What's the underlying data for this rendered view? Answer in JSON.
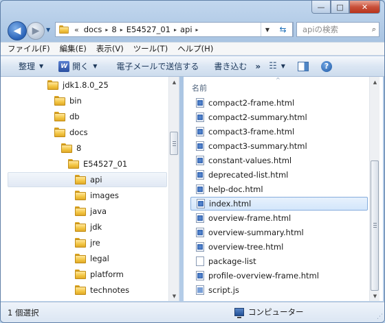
{
  "window": {
    "caption": {
      "minimize": "—",
      "maximize": "□",
      "close": "✕"
    }
  },
  "nav": {
    "back_glyph": "◀",
    "forward_glyph": "▶",
    "history_glyph": "▼",
    "address": {
      "overflow": "«",
      "crumbs": [
        "docs",
        "8",
        "E54527_01",
        "api"
      ],
      "separator": "▸",
      "dropdown_glyph": "▼"
    },
    "refresh_glyph": "⇆",
    "search": {
      "placeholder": "apiの検索",
      "icon": "search-icon",
      "glyph": "⌕"
    }
  },
  "menu": [
    "ファイル(F)",
    "編集(E)",
    "表示(V)",
    "ツール(T)",
    "ヘルプ(H)"
  ],
  "toolbar": {
    "organize": "整理",
    "open": "開く",
    "open_icon_glyph": "W",
    "email": "電子メールで送信する",
    "burn": "書き込む",
    "more": "»",
    "view_glyph": "☷",
    "caret": "▼",
    "help_glyph": "?"
  },
  "tree": {
    "items": [
      {
        "label": "jdk1.8.0_25",
        "indent": 0
      },
      {
        "label": "bin",
        "indent": 1
      },
      {
        "label": "db",
        "indent": 1
      },
      {
        "label": "docs",
        "indent": 1
      },
      {
        "label": "8",
        "indent": 2
      },
      {
        "label": "E54527_01",
        "indent": 3
      },
      {
        "label": "api",
        "indent": 4,
        "selected": true
      },
      {
        "label": "images",
        "indent": 4
      },
      {
        "label": "java",
        "indent": 4
      },
      {
        "label": "jdk",
        "indent": 4
      },
      {
        "label": "jre",
        "indent": 4
      },
      {
        "label": "legal",
        "indent": 4
      },
      {
        "label": "platform",
        "indent": 4
      },
      {
        "label": "technotes",
        "indent": 4
      }
    ],
    "scroll_up": "▲",
    "scroll_down": "▼"
  },
  "content": {
    "column_name": "名前",
    "sort_glyph": "^",
    "files": [
      {
        "name": "compact2-frame.html",
        "type": "html"
      },
      {
        "name": "compact2-summary.html",
        "type": "html"
      },
      {
        "name": "compact3-frame.html",
        "type": "html"
      },
      {
        "name": "compact3-summary.html",
        "type": "html"
      },
      {
        "name": "constant-values.html",
        "type": "html"
      },
      {
        "name": "deprecated-list.html",
        "type": "html"
      },
      {
        "name": "help-doc.html",
        "type": "html"
      },
      {
        "name": "index.html",
        "type": "html",
        "selected": true
      },
      {
        "name": "overview-frame.html",
        "type": "html"
      },
      {
        "name": "overview-summary.html",
        "type": "html"
      },
      {
        "name": "overview-tree.html",
        "type": "html"
      },
      {
        "name": "package-list",
        "type": "plain"
      },
      {
        "name": "profile-overview-frame.html",
        "type": "html"
      },
      {
        "name": "script.js",
        "type": "js"
      }
    ],
    "scroll_up": "▲",
    "scroll_down": "▼"
  },
  "status": {
    "selection": "1 個選択",
    "location": "コンピューター",
    "grip": "⋰"
  }
}
